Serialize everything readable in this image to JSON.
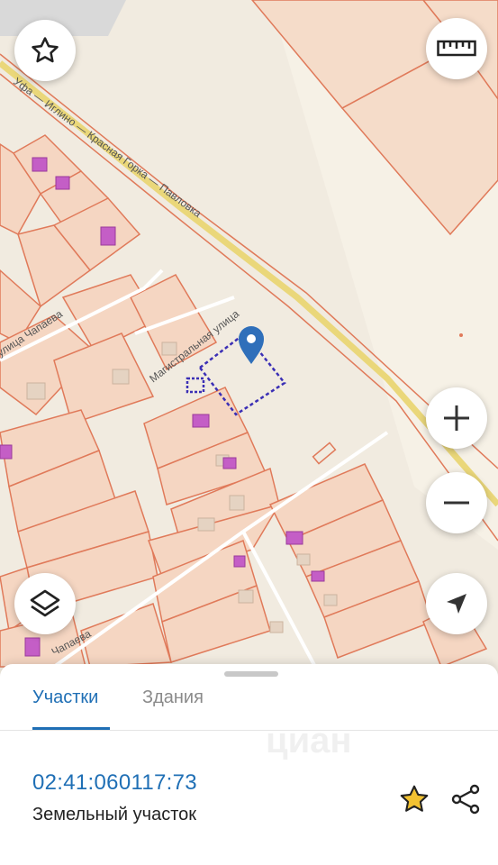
{
  "map": {
    "street_labels": {
      "highway": "Уфа — Иглино — Красная Горка — Павловка",
      "magistral": "Магистральная улица",
      "chapaeva": "улица Чапаева",
      "chapaeva_short": "Чапаева"
    },
    "marker_icon": "location-pin-icon",
    "colors": {
      "parcel_stroke": "#e07a5a",
      "parcel_fill": "#f5d6c2",
      "building": "#c45ec6",
      "road": "#ead77a",
      "selected": "#3b2fb5"
    }
  },
  "controls": {
    "favorites_icon": "star-outline-icon",
    "ruler_icon": "ruler-icon",
    "zoom_in_icon": "plus-icon",
    "zoom_out_icon": "minus-icon",
    "layers_icon": "layers-icon",
    "locate_icon": "navigation-arrow-icon"
  },
  "sheet": {
    "tabs": [
      {
        "label": "Участки",
        "active": true
      },
      {
        "label": "Здания",
        "active": false
      }
    ],
    "result": {
      "cadastral_number": "02:41:060117:73",
      "object_type": "Земельный участок"
    },
    "favorite_icon": "star-filled-icon",
    "share_icon": "share-icon",
    "watermark": "циан"
  }
}
